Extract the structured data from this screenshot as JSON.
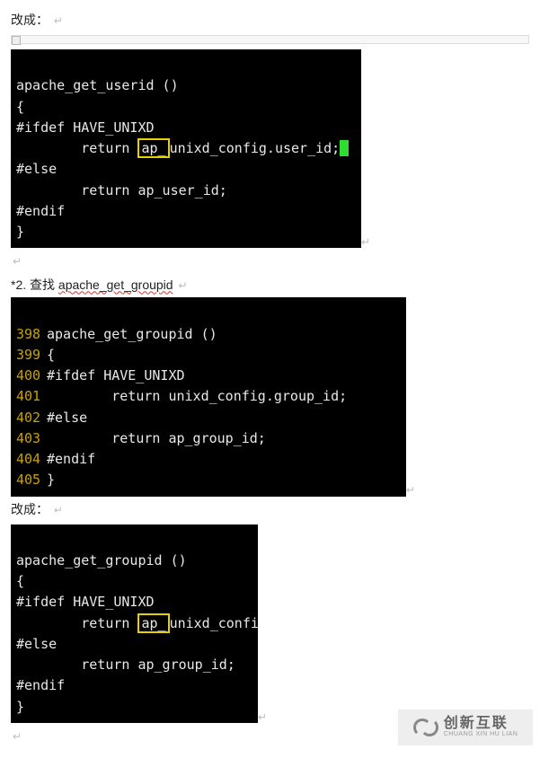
{
  "para1": "改成：",
  "block1": {
    "l1": "apache_get_userid ()",
    "l2": "{",
    "l3": "#ifdef HAVE_UNIXD",
    "l4_pre": "        return ",
    "l4_hl": "ap_",
    "l4_post": "unixd_config.user_id;",
    "l5": "#else",
    "l6": "        return ap_user_id;",
    "l7": "#endif",
    "l8": "}"
  },
  "item2_prefix": "*2.",
  "item2_label": "查找 ",
  "item2_func": "apache_get_groupid",
  "block2": {
    "lines": [
      {
        "no": "398",
        "txt": "apache_get_groupid ()"
      },
      {
        "no": "399",
        "txt": "{"
      },
      {
        "no": "400",
        "txt": "#ifdef HAVE_UNIXD"
      },
      {
        "no": "401",
        "txt": "        return unixd_config.group_id;"
      },
      {
        "no": "402",
        "txt": "#else"
      },
      {
        "no": "403",
        "txt": "        return ap_group_id;"
      },
      {
        "no": "404",
        "txt": "#endif"
      },
      {
        "no": "405",
        "txt": "}"
      }
    ]
  },
  "para3": "改成：",
  "block3": {
    "l1": "apache_get_groupid ()",
    "l2": "{",
    "l3": "#ifdef HAVE_UNIXD",
    "l4_pre": "        return ",
    "l4_hl": "ap_",
    "l4_post": "unixd_confi",
    "l5": "#else",
    "l6": "        return ap_group_id;",
    "l7": "#endif",
    "l8": "}"
  },
  "watermark": {
    "zh": "创新互联",
    "en": "CHUANG XIN HU LIAN"
  },
  "crlf": "↵"
}
